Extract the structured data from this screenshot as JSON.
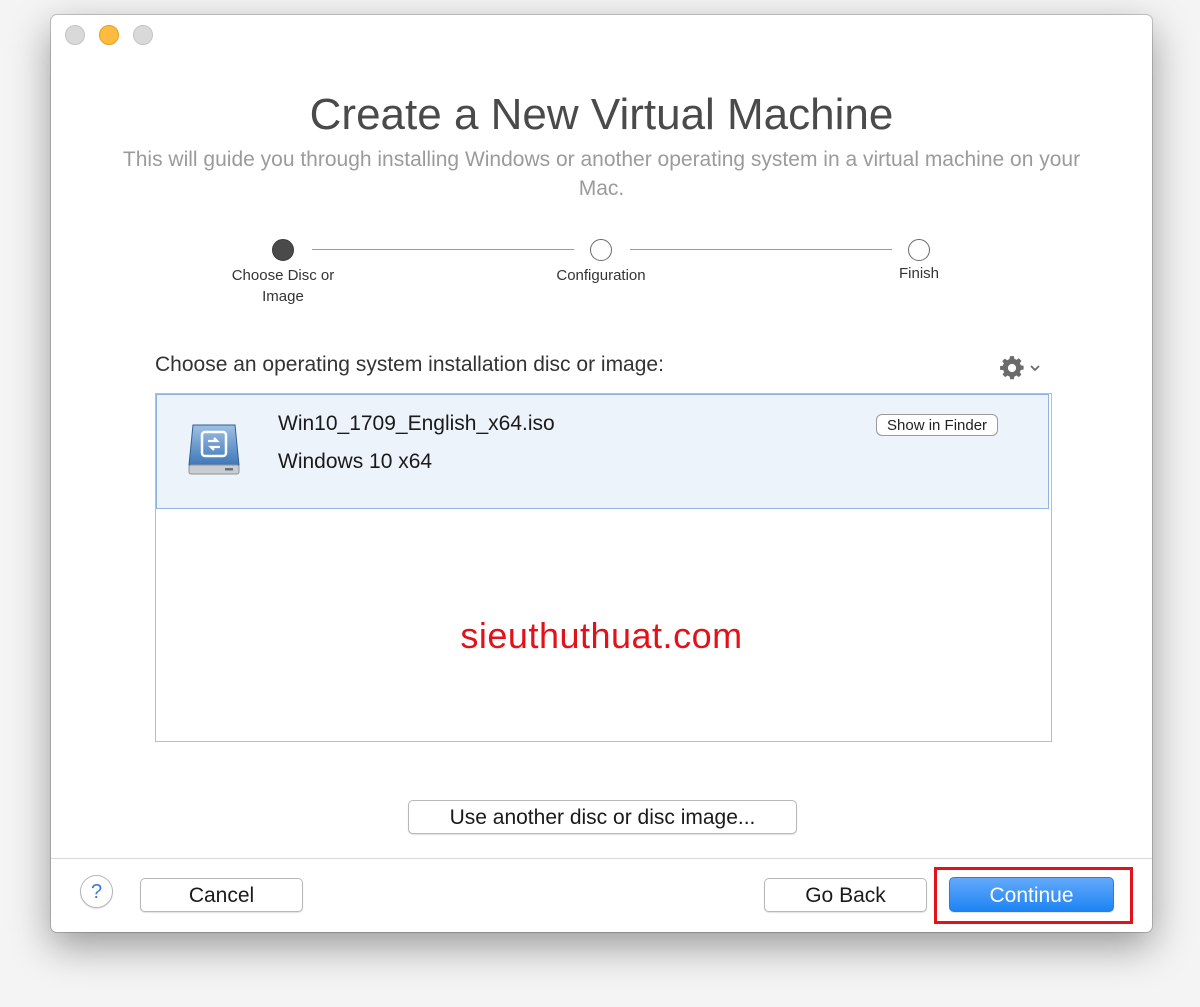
{
  "window": {
    "title": "Create a New Virtual Machine",
    "subtitle": "This will guide you through installing Windows or another operating system in a virtual machine on your Mac."
  },
  "steps": [
    {
      "label": "Choose Disc or Image",
      "state": "current"
    },
    {
      "label": "Configuration",
      "state": "pending"
    },
    {
      "label": "Finish",
      "state": "pending"
    }
  ],
  "source": {
    "label": "Choose an operating system installation disc or image:",
    "settings_icon": "gear-icon",
    "items": [
      {
        "filename": "Win10_1709_English_x64.iso",
        "os": "Windows 10 x64",
        "icon": "disk-image-icon",
        "selected": true,
        "action_label": "Show in Finder"
      }
    ],
    "use_another_label": "Use another disc or disc image..."
  },
  "watermark": "sieuthuthuat.com",
  "footer": {
    "help_label": "?",
    "cancel_label": "Cancel",
    "back_label": "Go Back",
    "continue_label": "Continue"
  },
  "colors": {
    "accent": "#1d84f3",
    "highlight": "#e2121b",
    "selection": "#edf3fb",
    "minimize": "#fdbc40"
  }
}
